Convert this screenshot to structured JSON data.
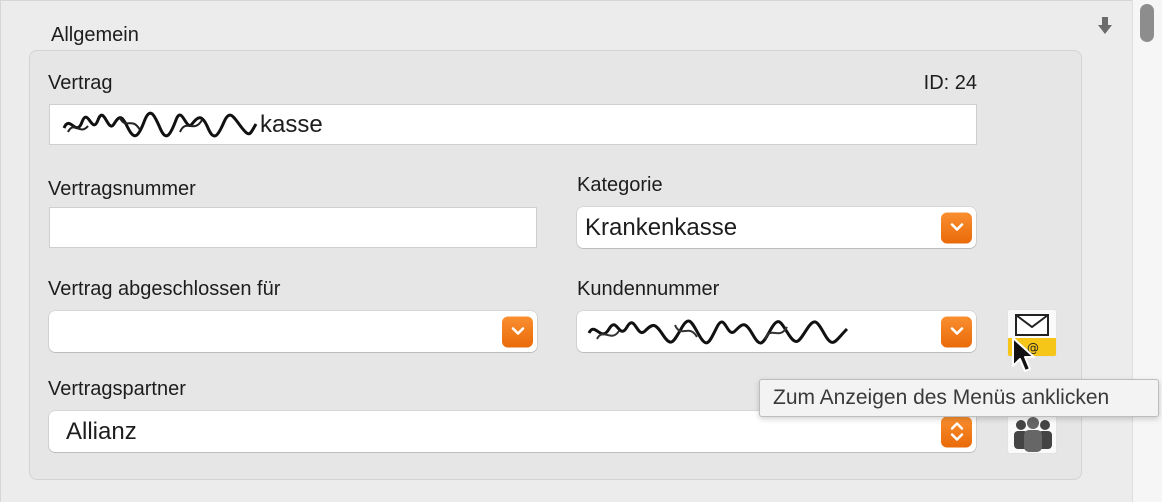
{
  "section": {
    "title": "Allgemein"
  },
  "vertrag": {
    "label": "Vertrag",
    "id_label": "ID: 24",
    "value_visible_suffix": "kasse"
  },
  "vertragsnummer": {
    "label": "Vertragsnummer",
    "value": ""
  },
  "kategorie": {
    "label": "Kategorie",
    "value": "Krankenkasse"
  },
  "abgeschlossen_fuer": {
    "label": "Vertrag abgeschlossen für",
    "value": ""
  },
  "kundennummer": {
    "label": "Kundennummer",
    "value": ""
  },
  "vertragspartner": {
    "label": "Vertragspartner",
    "value": "Allianz"
  },
  "tooltip": {
    "text": "Zum Anzeigen des Menüs anklicken"
  },
  "icons": {
    "scroll_down": "down-arrow-icon",
    "email": "email-icon",
    "contacts": "people-icon",
    "cursor": "mouse-pointer-icon"
  },
  "colors": {
    "accent": "#f07a18",
    "group_background": "#e6e6e6",
    "page_background": "#ececec"
  }
}
